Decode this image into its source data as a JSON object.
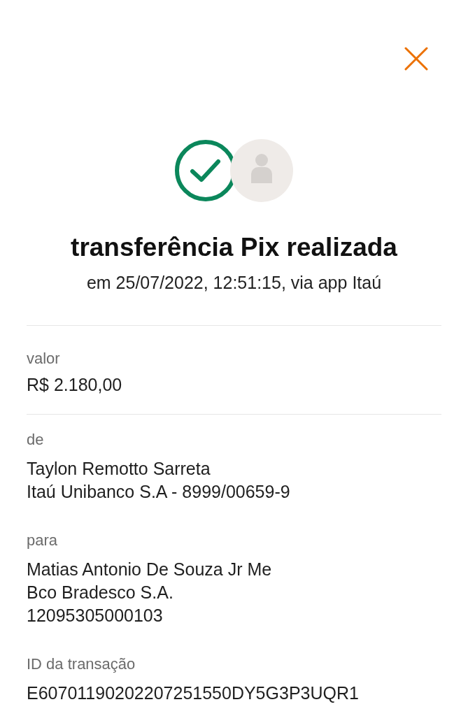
{
  "header": {
    "title": "transferência Pix realizada",
    "subtitle": "em 25/07/2022, 12:51:15, via app Itaú"
  },
  "amount": {
    "label": "valor",
    "value": "R$ 2.180,00"
  },
  "details": [
    {
      "label": "de",
      "lines": [
        "Taylon Remotto Sarreta",
        "Itaú Unibanco S.A - 8999/00659-9"
      ]
    },
    {
      "label": "para",
      "lines": [
        "Matias Antonio De Souza Jr Me",
        "Bco Bradesco S.A.",
        "12095305000103"
      ]
    },
    {
      "label": "ID da transação",
      "lines": [
        "E60701190202207251550DY5G3P3UQR1"
      ]
    }
  ]
}
